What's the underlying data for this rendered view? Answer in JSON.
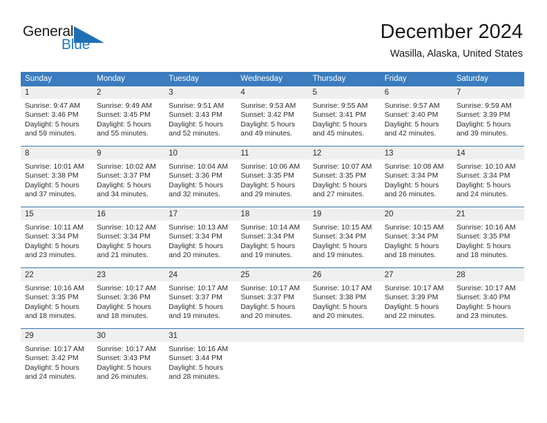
{
  "brand": {
    "name_top": "General",
    "name_bottom": "Blue",
    "triangle_icon": "blue-triangle-icon",
    "accent_color": "#1f7ac4"
  },
  "header": {
    "title": "December 2024",
    "subtitle": "Wasilla, Alaska, United States"
  },
  "calendar": {
    "header_bg": "#3a7cbe",
    "daynum_bg": "#efefef",
    "divider_color": "#2e6da4",
    "weekdays": [
      "Sunday",
      "Monday",
      "Tuesday",
      "Wednesday",
      "Thursday",
      "Friday",
      "Saturday"
    ],
    "weeks": [
      [
        {
          "day": "1",
          "sunrise": "Sunrise: 9:47 AM",
          "sunset": "Sunset: 3:46 PM",
          "daylight1": "Daylight: 5 hours",
          "daylight2": "and 59 minutes."
        },
        {
          "day": "2",
          "sunrise": "Sunrise: 9:49 AM",
          "sunset": "Sunset: 3:45 PM",
          "daylight1": "Daylight: 5 hours",
          "daylight2": "and 55 minutes."
        },
        {
          "day": "3",
          "sunrise": "Sunrise: 9:51 AM",
          "sunset": "Sunset: 3:43 PM",
          "daylight1": "Daylight: 5 hours",
          "daylight2": "and 52 minutes."
        },
        {
          "day": "4",
          "sunrise": "Sunrise: 9:53 AM",
          "sunset": "Sunset: 3:42 PM",
          "daylight1": "Daylight: 5 hours",
          "daylight2": "and 49 minutes."
        },
        {
          "day": "5",
          "sunrise": "Sunrise: 9:55 AM",
          "sunset": "Sunset: 3:41 PM",
          "daylight1": "Daylight: 5 hours",
          "daylight2": "and 45 minutes."
        },
        {
          "day": "6",
          "sunrise": "Sunrise: 9:57 AM",
          "sunset": "Sunset: 3:40 PM",
          "daylight1": "Daylight: 5 hours",
          "daylight2": "and 42 minutes."
        },
        {
          "day": "7",
          "sunrise": "Sunrise: 9:59 AM",
          "sunset": "Sunset: 3:39 PM",
          "daylight1": "Daylight: 5 hours",
          "daylight2": "and 39 minutes."
        }
      ],
      [
        {
          "day": "8",
          "sunrise": "Sunrise: 10:01 AM",
          "sunset": "Sunset: 3:38 PM",
          "daylight1": "Daylight: 5 hours",
          "daylight2": "and 37 minutes."
        },
        {
          "day": "9",
          "sunrise": "Sunrise: 10:02 AM",
          "sunset": "Sunset: 3:37 PM",
          "daylight1": "Daylight: 5 hours",
          "daylight2": "and 34 minutes."
        },
        {
          "day": "10",
          "sunrise": "Sunrise: 10:04 AM",
          "sunset": "Sunset: 3:36 PM",
          "daylight1": "Daylight: 5 hours",
          "daylight2": "and 32 minutes."
        },
        {
          "day": "11",
          "sunrise": "Sunrise: 10:06 AM",
          "sunset": "Sunset: 3:35 PM",
          "daylight1": "Daylight: 5 hours",
          "daylight2": "and 29 minutes."
        },
        {
          "day": "12",
          "sunrise": "Sunrise: 10:07 AM",
          "sunset": "Sunset: 3:35 PM",
          "daylight1": "Daylight: 5 hours",
          "daylight2": "and 27 minutes."
        },
        {
          "day": "13",
          "sunrise": "Sunrise: 10:08 AM",
          "sunset": "Sunset: 3:34 PM",
          "daylight1": "Daylight: 5 hours",
          "daylight2": "and 26 minutes."
        },
        {
          "day": "14",
          "sunrise": "Sunrise: 10:10 AM",
          "sunset": "Sunset: 3:34 PM",
          "daylight1": "Daylight: 5 hours",
          "daylight2": "and 24 minutes."
        }
      ],
      [
        {
          "day": "15",
          "sunrise": "Sunrise: 10:11 AM",
          "sunset": "Sunset: 3:34 PM",
          "daylight1": "Daylight: 5 hours",
          "daylight2": "and 23 minutes."
        },
        {
          "day": "16",
          "sunrise": "Sunrise: 10:12 AM",
          "sunset": "Sunset: 3:34 PM",
          "daylight1": "Daylight: 5 hours",
          "daylight2": "and 21 minutes."
        },
        {
          "day": "17",
          "sunrise": "Sunrise: 10:13 AM",
          "sunset": "Sunset: 3:34 PM",
          "daylight1": "Daylight: 5 hours",
          "daylight2": "and 20 minutes."
        },
        {
          "day": "18",
          "sunrise": "Sunrise: 10:14 AM",
          "sunset": "Sunset: 3:34 PM",
          "daylight1": "Daylight: 5 hours",
          "daylight2": "and 19 minutes."
        },
        {
          "day": "19",
          "sunrise": "Sunrise: 10:15 AM",
          "sunset": "Sunset: 3:34 PM",
          "daylight1": "Daylight: 5 hours",
          "daylight2": "and 19 minutes."
        },
        {
          "day": "20",
          "sunrise": "Sunrise: 10:15 AM",
          "sunset": "Sunset: 3:34 PM",
          "daylight1": "Daylight: 5 hours",
          "daylight2": "and 18 minutes."
        },
        {
          "day": "21",
          "sunrise": "Sunrise: 10:16 AM",
          "sunset": "Sunset: 3:35 PM",
          "daylight1": "Daylight: 5 hours",
          "daylight2": "and 18 minutes."
        }
      ],
      [
        {
          "day": "22",
          "sunrise": "Sunrise: 10:16 AM",
          "sunset": "Sunset: 3:35 PM",
          "daylight1": "Daylight: 5 hours",
          "daylight2": "and 18 minutes."
        },
        {
          "day": "23",
          "sunrise": "Sunrise: 10:17 AM",
          "sunset": "Sunset: 3:36 PM",
          "daylight1": "Daylight: 5 hours",
          "daylight2": "and 18 minutes."
        },
        {
          "day": "24",
          "sunrise": "Sunrise: 10:17 AM",
          "sunset": "Sunset: 3:37 PM",
          "daylight1": "Daylight: 5 hours",
          "daylight2": "and 19 minutes."
        },
        {
          "day": "25",
          "sunrise": "Sunrise: 10:17 AM",
          "sunset": "Sunset: 3:37 PM",
          "daylight1": "Daylight: 5 hours",
          "daylight2": "and 20 minutes."
        },
        {
          "day": "26",
          "sunrise": "Sunrise: 10:17 AM",
          "sunset": "Sunset: 3:38 PM",
          "daylight1": "Daylight: 5 hours",
          "daylight2": "and 20 minutes."
        },
        {
          "day": "27",
          "sunrise": "Sunrise: 10:17 AM",
          "sunset": "Sunset: 3:39 PM",
          "daylight1": "Daylight: 5 hours",
          "daylight2": "and 22 minutes."
        },
        {
          "day": "28",
          "sunrise": "Sunrise: 10:17 AM",
          "sunset": "Sunset: 3:40 PM",
          "daylight1": "Daylight: 5 hours",
          "daylight2": "and 23 minutes."
        }
      ],
      [
        {
          "day": "29",
          "sunrise": "Sunrise: 10:17 AM",
          "sunset": "Sunset: 3:42 PM",
          "daylight1": "Daylight: 5 hours",
          "daylight2": "and 24 minutes."
        },
        {
          "day": "30",
          "sunrise": "Sunrise: 10:17 AM",
          "sunset": "Sunset: 3:43 PM",
          "daylight1": "Daylight: 5 hours",
          "daylight2": "and 26 minutes."
        },
        {
          "day": "31",
          "sunrise": "Sunrise: 10:16 AM",
          "sunset": "Sunset: 3:44 PM",
          "daylight1": "Daylight: 5 hours",
          "daylight2": "and 28 minutes."
        },
        {
          "day": "",
          "sunrise": "",
          "sunset": "",
          "daylight1": "",
          "daylight2": ""
        },
        {
          "day": "",
          "sunrise": "",
          "sunset": "",
          "daylight1": "",
          "daylight2": ""
        },
        {
          "day": "",
          "sunrise": "",
          "sunset": "",
          "daylight1": "",
          "daylight2": ""
        },
        {
          "day": "",
          "sunrise": "",
          "sunset": "",
          "daylight1": "",
          "daylight2": ""
        }
      ]
    ]
  }
}
